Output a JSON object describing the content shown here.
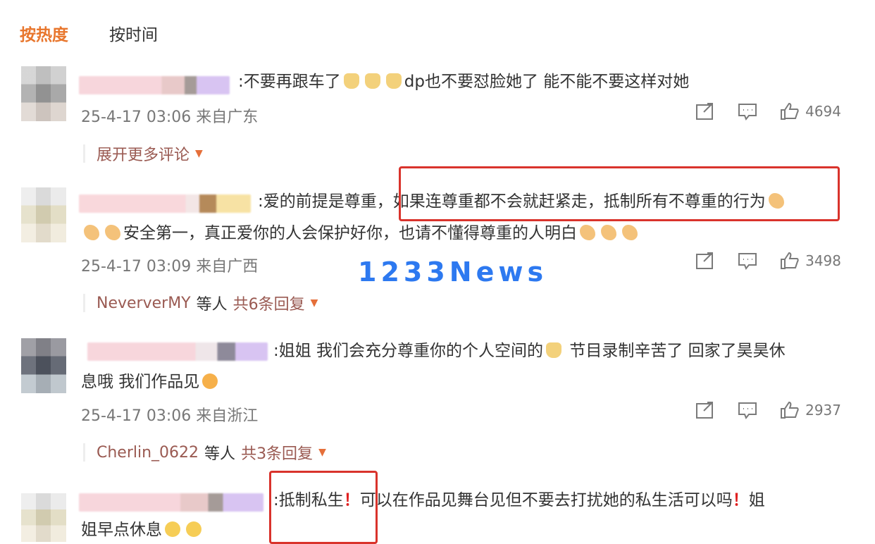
{
  "tabs": {
    "hot": "按热度",
    "time": "按时间"
  },
  "comments": [
    {
      "line1": ":不要再跟车了",
      "line1b": "dp也不要怼脸她了 能不能不要这样对她",
      "time": "25-4-17 03:06 来自广东",
      "likes": "4694",
      "expand": "展开更多评论"
    },
    {
      "line1": ":爱的前提是尊重，",
      "line1b": "如果连尊重都不会就赶紧走，抵制所有不尊重的行为",
      "line2": "安全第一，真正爱你的人会保护好你，也请不懂得尊重的人明白",
      "time": "25-4-17 03:09 来自广西",
      "likes": "3498",
      "reply_user": "NeververMY",
      "reply_mid": "等人",
      "reply_count": "共6条回复"
    },
    {
      "line1": ":姐姐 我们会充分尊重你的个人空间的",
      "line1b": "节目录制辛苦了 回家了昊昊休",
      "line2": "息哦 我们作品见",
      "time": "25-4-17 03:06 来自浙江",
      "likes": "2937",
      "reply_user": "Cherlin_0622",
      "reply_mid": "等人",
      "reply_count": "共3条回复"
    },
    {
      "line1": ":抵制私生",
      "line1b": "可以在作品见舞台见但不要去打扰她的私生活可以吗",
      "line1c": "姐",
      "line2": "姐早点休息",
      "excl": "！"
    }
  ],
  "watermark": "1233News",
  "icons": {
    "share": "share-icon",
    "comment": "comment-icon",
    "like": "like-icon",
    "caret": "caret-down-icon"
  },
  "colors": {
    "accent": "#e8762d",
    "highlight_box": "#d9332c",
    "watermark": "#2d79f0"
  }
}
